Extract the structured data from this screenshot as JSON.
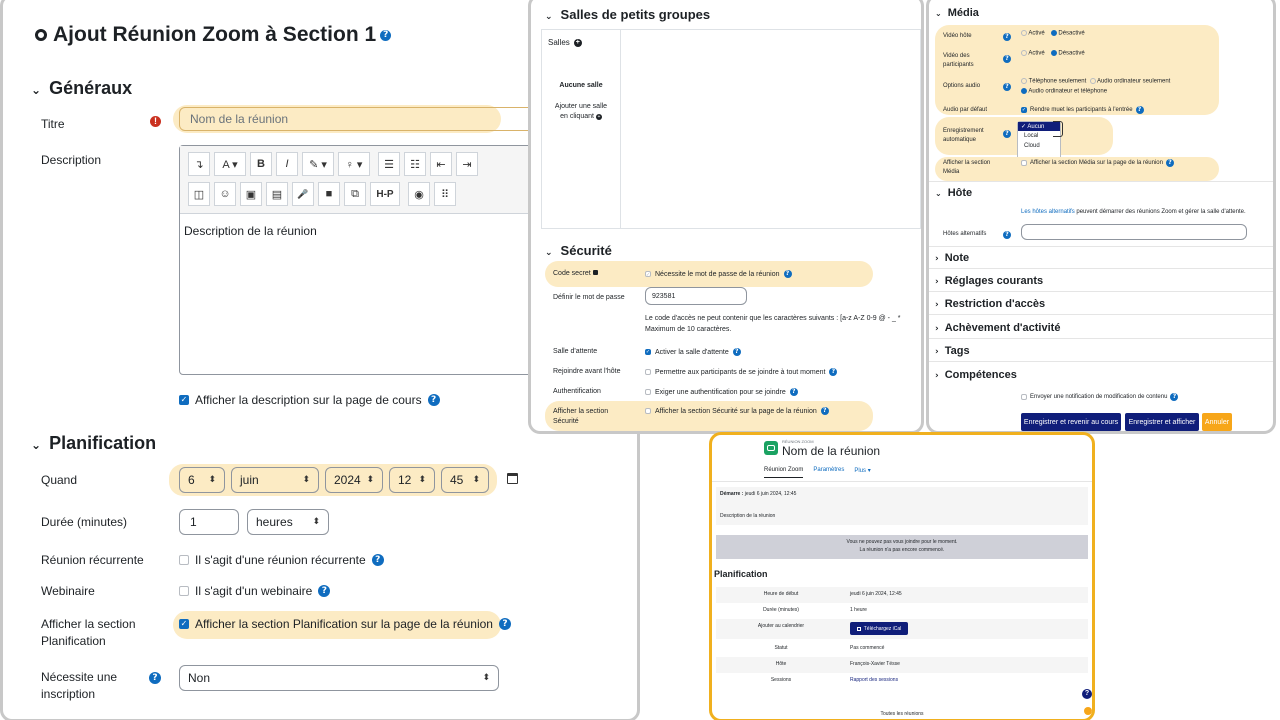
{
  "main": {
    "title": "Ajout Réunion Zoom à Section 1",
    "generaux": "Généraux",
    "titre_label": "Titre",
    "titre_placeholder": "Nom de la réunion",
    "description_label": "Description",
    "description_placeholder": "Description de la réunion",
    "show_description": "Afficher la description sur la page de cours",
    "planification": "Planification",
    "quand_label": "Quand",
    "day": "6",
    "month": "juin",
    "year": "2024",
    "hour": "12",
    "minute": "45",
    "duree_label": "Durée (minutes)",
    "duree_value": "1",
    "duree_unit": "heures",
    "recurrente_label": "Réunion récurrente",
    "recurrente_text": "Il s'agit d'une réunion récurrente",
    "webinaire_label": "Webinaire",
    "webinaire_text": "Il s'agit d'un webinaire",
    "afficher_plan_label": "Afficher la section Planification",
    "afficher_plan_text": "Afficher la section Planification sur la page de la réunion",
    "inscription_label": "Nécessite une inscription",
    "inscription_value": "Non"
  },
  "toolbar": {
    "row1": [
      "↴",
      "A ▾",
      "B",
      "I",
      "✎ ▾",
      "♀ ▾",
      "☰",
      "☷",
      "⇤",
      "⇥"
    ],
    "row2": [
      "◫",
      "☺",
      "▣",
      "▤",
      "🎤",
      "■",
      "⧉",
      "H-P",
      "◉",
      "⠿"
    ]
  },
  "rooms": {
    "title": "Salles de petits groupes",
    "salles": "Salles",
    "aucune": "Aucune salle",
    "ajouter": "Ajouter une salle en cliquant"
  },
  "security": {
    "title": "Sécurité",
    "code_label": "Code secret",
    "code_text": "Nécessite le mot de passe de la réunion",
    "pwd_label": "Définir le mot de passe",
    "pwd_value": "923581",
    "pwd_help1": "Le code d'accès ne peut contenir que les caractères suivants : [a-z A-Z 0-9 @ - _ *",
    "pwd_help2": "Maximum de 10 caractères.",
    "waiting_label": "Salle d'attente",
    "waiting_text": "Activer la salle d'attente",
    "join_label": "Rejoindre avant l'hôte",
    "join_text": "Permettre aux participants de se joindre à tout moment",
    "auth_label": "Authentification",
    "auth_text": "Exiger une authentification pour se joindre",
    "show_label": "Afficher la section Sécurité",
    "show_text": "Afficher la section Sécurité sur la page de la réunion"
  },
  "media": {
    "title": "Média",
    "video_host": "Vidéo hôte",
    "video_part": "Vidéo des participants",
    "active": "Activé",
    "inactive": "Désactivé",
    "audio_opts": "Options audio",
    "tel_only": "Téléphone seulement",
    "comp_only": "Audio ordinateur seulement",
    "both": "Audio ordinateur et téléphone",
    "audio_default": "Audio par défaut",
    "mute": "Rendre muet les participants à l'entrée",
    "recording": "Enregistrement automatique",
    "rec_options": [
      "Aucun",
      "Local",
      "Cloud"
    ],
    "show_media": "Afficher la section Média",
    "show_media_text": "Afficher la section Média sur la page de la réunion"
  },
  "host": {
    "title": "Hôte",
    "link": "Les hôtes alternatifs",
    "desc": " peuvent démarrer des réunions Zoom et gérer la salle d'attente.",
    "alt_label": "Hôtes alternatifs"
  },
  "collapsed": [
    "Note",
    "Réglages courants",
    "Restriction d'accès",
    "Achèvement d'activité",
    "Tags",
    "Compétences"
  ],
  "notify": "Envoyer une notification de modification de contenu",
  "buttons": {
    "save_return": "Enregistrer et revenir au cours",
    "save_show": "Enregistrer et afficher",
    "cancel": "Annuler"
  },
  "preview": {
    "kicker": "RÉUNION ZOOM",
    "title": "Nom de la réunion",
    "tabs": [
      "Réunion Zoom",
      "Paramètres",
      "Plus ▾"
    ],
    "start_label": "Démarre :",
    "start_value": " jeudi 6 juin 2024, 12:45",
    "desc": "Description de la réunion",
    "notice1": "Vous ne pouvez pas vous joindre pour le moment.",
    "notice2": "La réunion n'a pas encore commencé.",
    "plan_title": "Planification",
    "rows": [
      {
        "label": "Heure de début",
        "value": "jeudi 6 juin 2024, 12:45"
      },
      {
        "label": "Durée (minutes)",
        "value": "1 heure"
      },
      {
        "label": "Ajouter au calendrier",
        "value": "Téléchargez iCal"
      },
      {
        "label": "Statut",
        "value": "Pas commencé"
      },
      {
        "label": "Hôte",
        "value": "François-Xavier Tésse"
      },
      {
        "label": "Sessions",
        "value": "Rapport des sessions"
      }
    ],
    "footer": "Toutes les réunions"
  },
  "colors": {
    "highlight": "#fcebc4",
    "accent": "#0f6cbf",
    "navy": "#101e7a",
    "orange": "#f7a619",
    "zoom_green": "#1aa262"
  }
}
